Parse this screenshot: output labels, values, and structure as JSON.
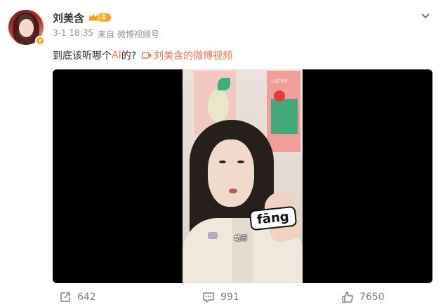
{
  "user": {
    "name": "刘美含",
    "level": "1",
    "verified_badge": "v"
  },
  "meta": {
    "time": "3-1 18:35",
    "source": "来自 微博视频号"
  },
  "post": {
    "text_before": "到底该听哪个",
    "text_link": "AI",
    "text_after": "的?",
    "video_link_label": "刘美含的微博视频"
  },
  "video": {
    "watermark": "小红书号",
    "sticker_text": "fāng",
    "subtitle": "坊币"
  },
  "actions": {
    "share_count": "642",
    "comment_count": "991",
    "like_count": "7650"
  },
  "icons": {
    "more": "chevron-down-icon",
    "crown": "crown-icon",
    "video": "video-camera-icon",
    "share": "share-icon",
    "comment": "comment-icon",
    "like": "thumbs-up-icon"
  },
  "colors": {
    "accent": "#eb7350",
    "meta": "#939393",
    "badge": "#f5a623"
  }
}
